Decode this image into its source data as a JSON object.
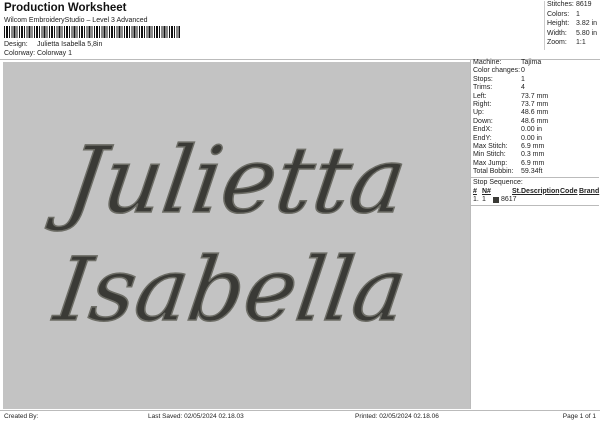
{
  "header": {
    "title": "Production Worksheet",
    "software": "Wilcom EmbroideryStudio – Level 3 Advanced",
    "design_label": "Design:",
    "design": "Julietta Isabella 5,8in",
    "colorway_label": "Colorway:",
    "colorway": "Colorway 1"
  },
  "summary": [
    {
      "k": "Stitches:",
      "v": "8619"
    },
    {
      "k": "Colors:",
      "v": "1"
    },
    {
      "k": "Height:",
      "v": "3.82 in"
    },
    {
      "k": "Width:",
      "v": "5.80 in"
    },
    {
      "k": "Zoom:",
      "v": "1:1"
    }
  ],
  "design_text": {
    "line1": "Julietta",
    "line2": "Isabella"
  },
  "details": [
    {
      "k": "Machine:",
      "v": "Tajima"
    },
    {
      "k": "Color changes:",
      "v": "0"
    },
    {
      "k": "Stops:",
      "v": "1"
    },
    {
      "k": "Trims:",
      "v": "4"
    },
    {
      "k": "Left:",
      "v": "73.7 mm"
    },
    {
      "k": "Right:",
      "v": "73.7 mm"
    },
    {
      "k": "Up:",
      "v": "48.6 mm"
    },
    {
      "k": "Down:",
      "v": "48.6 mm"
    },
    {
      "k": "EndX:",
      "v": "0.00 in"
    },
    {
      "k": "EndY:",
      "v": "0.00 in"
    },
    {
      "k": "Max Stitch:",
      "v": "6.9 mm"
    },
    {
      "k": "Min Stitch:",
      "v": "0.3 mm"
    },
    {
      "k": "Max Jump:",
      "v": "6.9 mm"
    },
    {
      "k": "Total Bobbin:",
      "v": "59.34ft"
    }
  ],
  "stop_sequence": {
    "label": "Stop Sequence:",
    "columns": [
      "#",
      "N#",
      "St.",
      "Description",
      "Code",
      "Brand"
    ],
    "rows": [
      {
        "num": "1.",
        "n": "1",
        "st": "8617",
        "color": "#3a3a36"
      }
    ]
  },
  "footer": {
    "created_by": "Created By:",
    "last_saved": "Last Saved: 02/05/2024 02.18.03",
    "printed": "Printed: 02/05/2024 02.18.06",
    "page": "Page 1 of 1"
  },
  "colors": {
    "thread": "#3a3a36",
    "canvas": "#c3c3c3"
  }
}
